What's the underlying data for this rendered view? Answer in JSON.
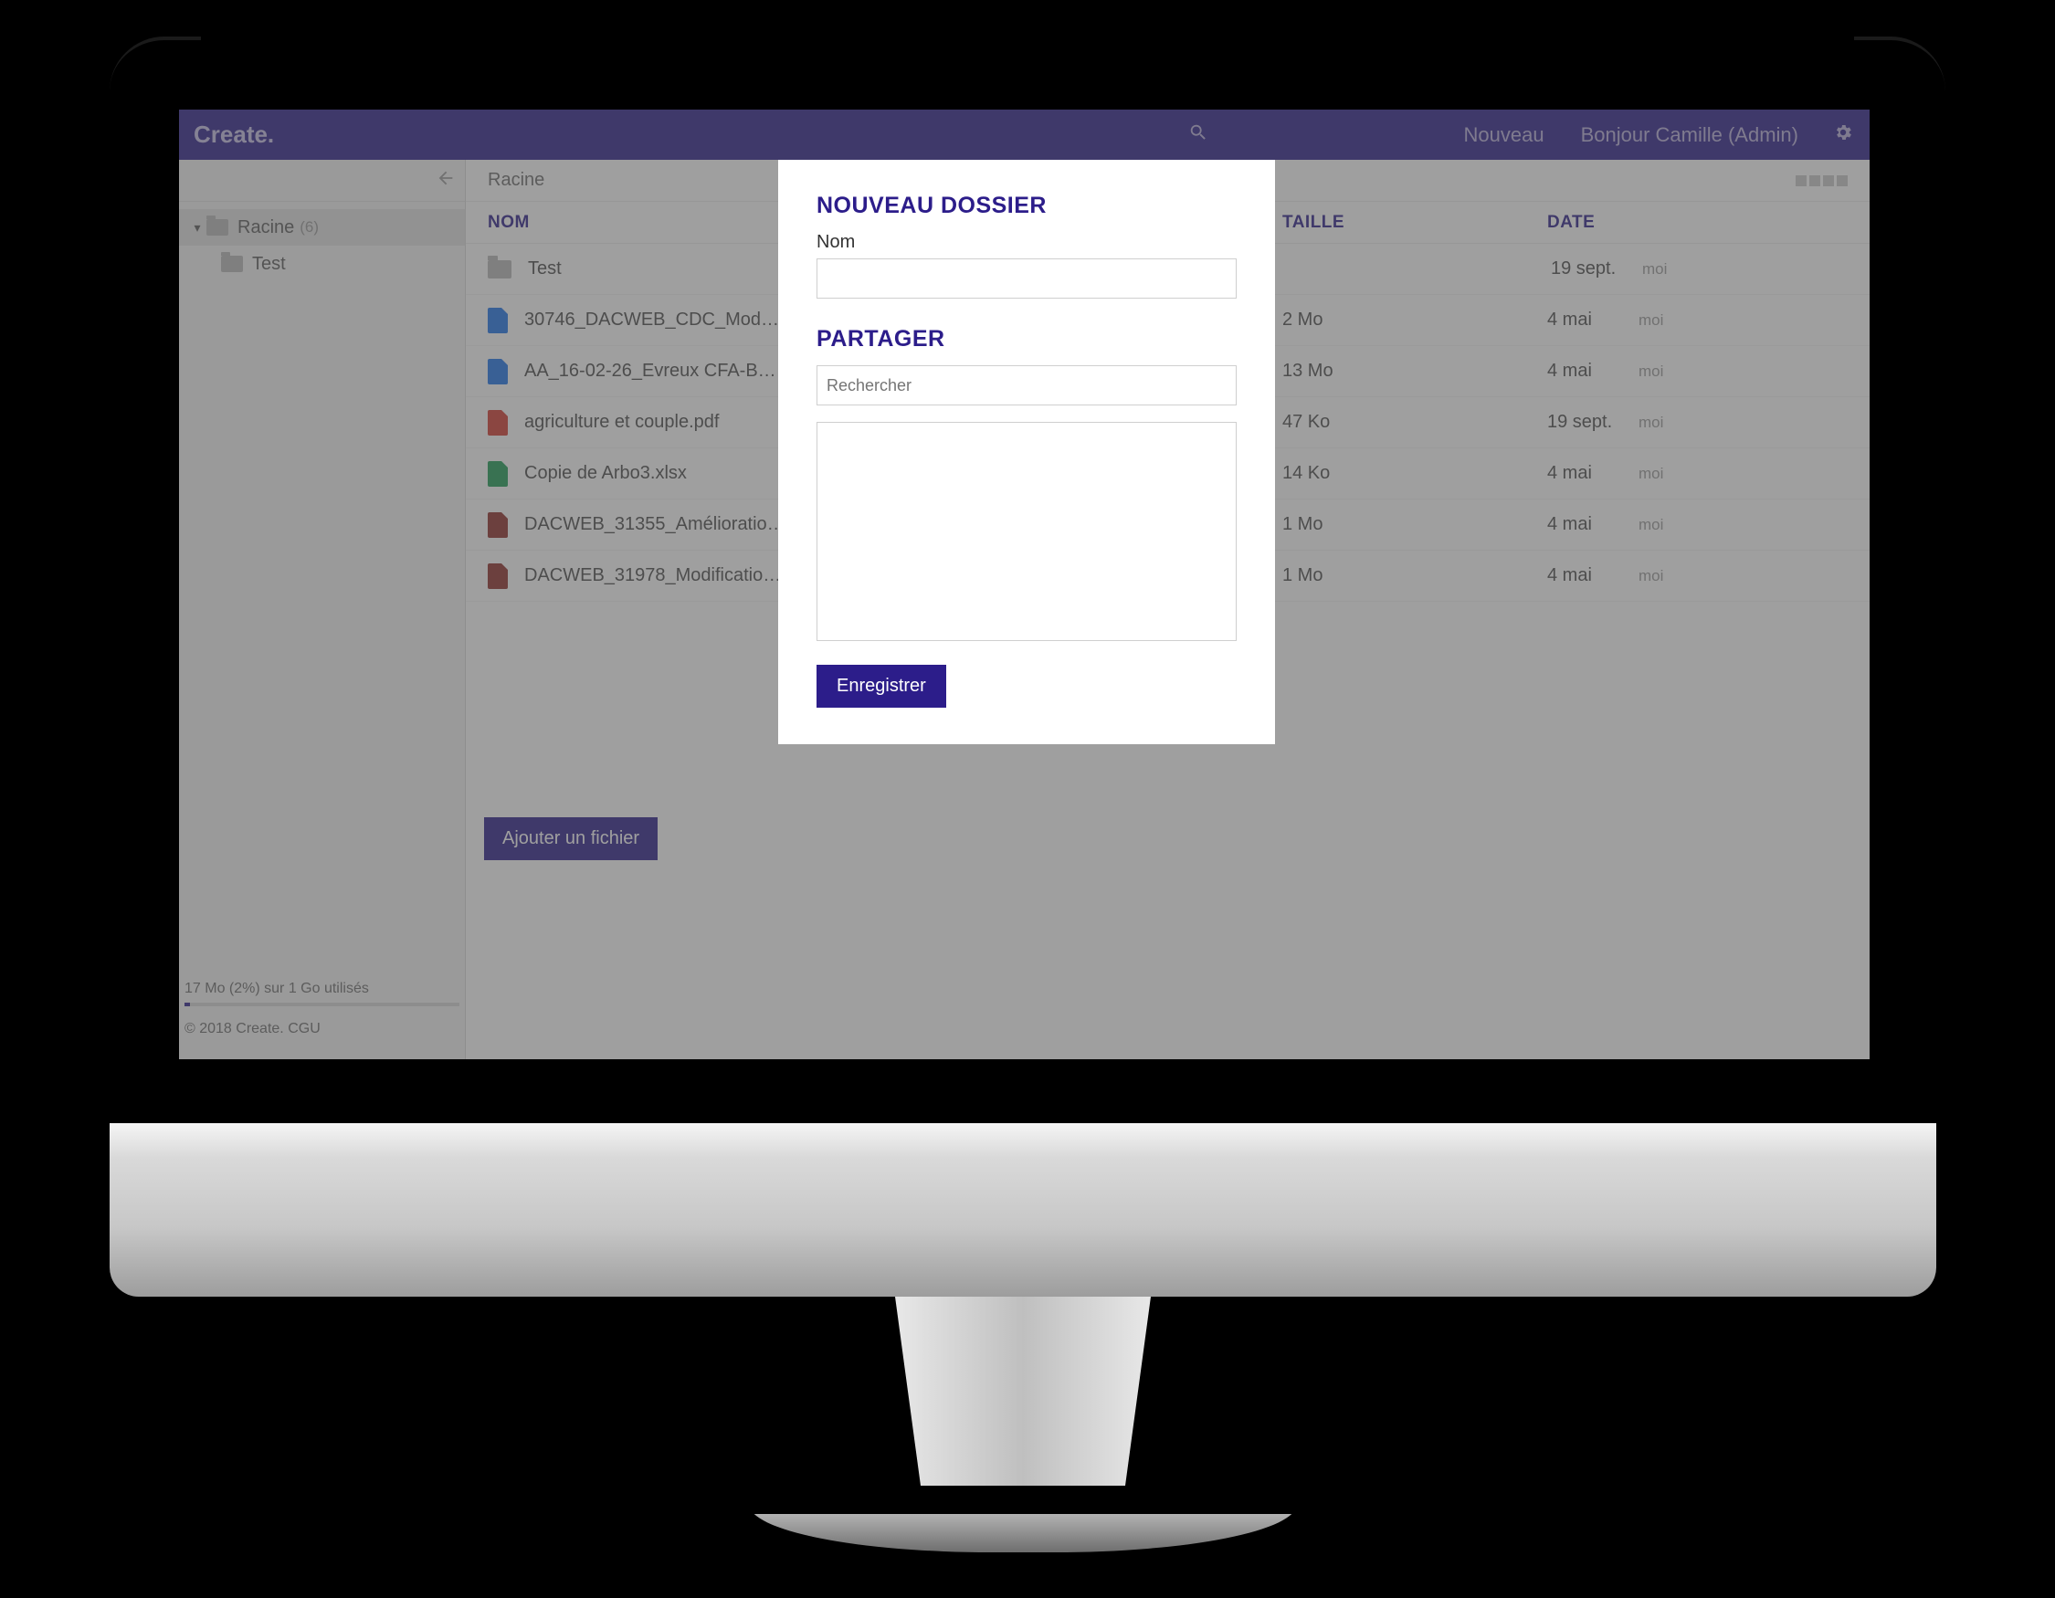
{
  "header": {
    "brand": "Create.",
    "new_label": "Nouveau",
    "greeting": "Bonjour Camille (Admin)"
  },
  "sidebar": {
    "root_label": "Racine",
    "root_count": "(6)",
    "children": [
      {
        "label": "Test"
      }
    ],
    "storage_text": "17 Mo (2%) sur 1 Go utilisés",
    "footer_text": "© 2018 Create. CGU"
  },
  "main": {
    "breadcrumb": "Racine",
    "columns": {
      "name": "NOM",
      "size": "TAILLE",
      "date": "DATE"
    },
    "rows": [
      {
        "icon": "folder",
        "name": "Test",
        "size": "",
        "date": "19 sept.",
        "owner": "moi"
      },
      {
        "icon": "doc-blue",
        "name": "30746_DACWEB_CDC_Mod…",
        "size": "2 Mo",
        "date": "4 mai",
        "owner": "moi"
      },
      {
        "icon": "doc-blue",
        "name": "AA_16-02-26_Evreux CFA-B…",
        "size": "13 Mo",
        "date": "4 mai",
        "owner": "moi"
      },
      {
        "icon": "doc-red",
        "name": "agriculture et couple.pdf",
        "size": "47 Ko",
        "date": "19 sept.",
        "owner": "moi"
      },
      {
        "icon": "doc-green",
        "name": "Copie de Arbo3.xlsx",
        "size": "14 Ko",
        "date": "4 mai",
        "owner": "moi"
      },
      {
        "icon": "doc-dred",
        "name": "DACWEB_31355_Amélioratio…",
        "size": "1 Mo",
        "date": "4 mai",
        "owner": "moi"
      },
      {
        "icon": "doc-dred",
        "name": "DACWEB_31978_Modificatio…",
        "size": "1 Mo",
        "date": "4 mai",
        "owner": "moi"
      }
    ],
    "add_button": "Ajouter un fichier"
  },
  "modal": {
    "title1": "NOUVEAU DOSSIER",
    "name_label": "Nom",
    "title2": "PARTAGER",
    "search_placeholder": "Rechercher",
    "save_label": "Enregistrer"
  }
}
